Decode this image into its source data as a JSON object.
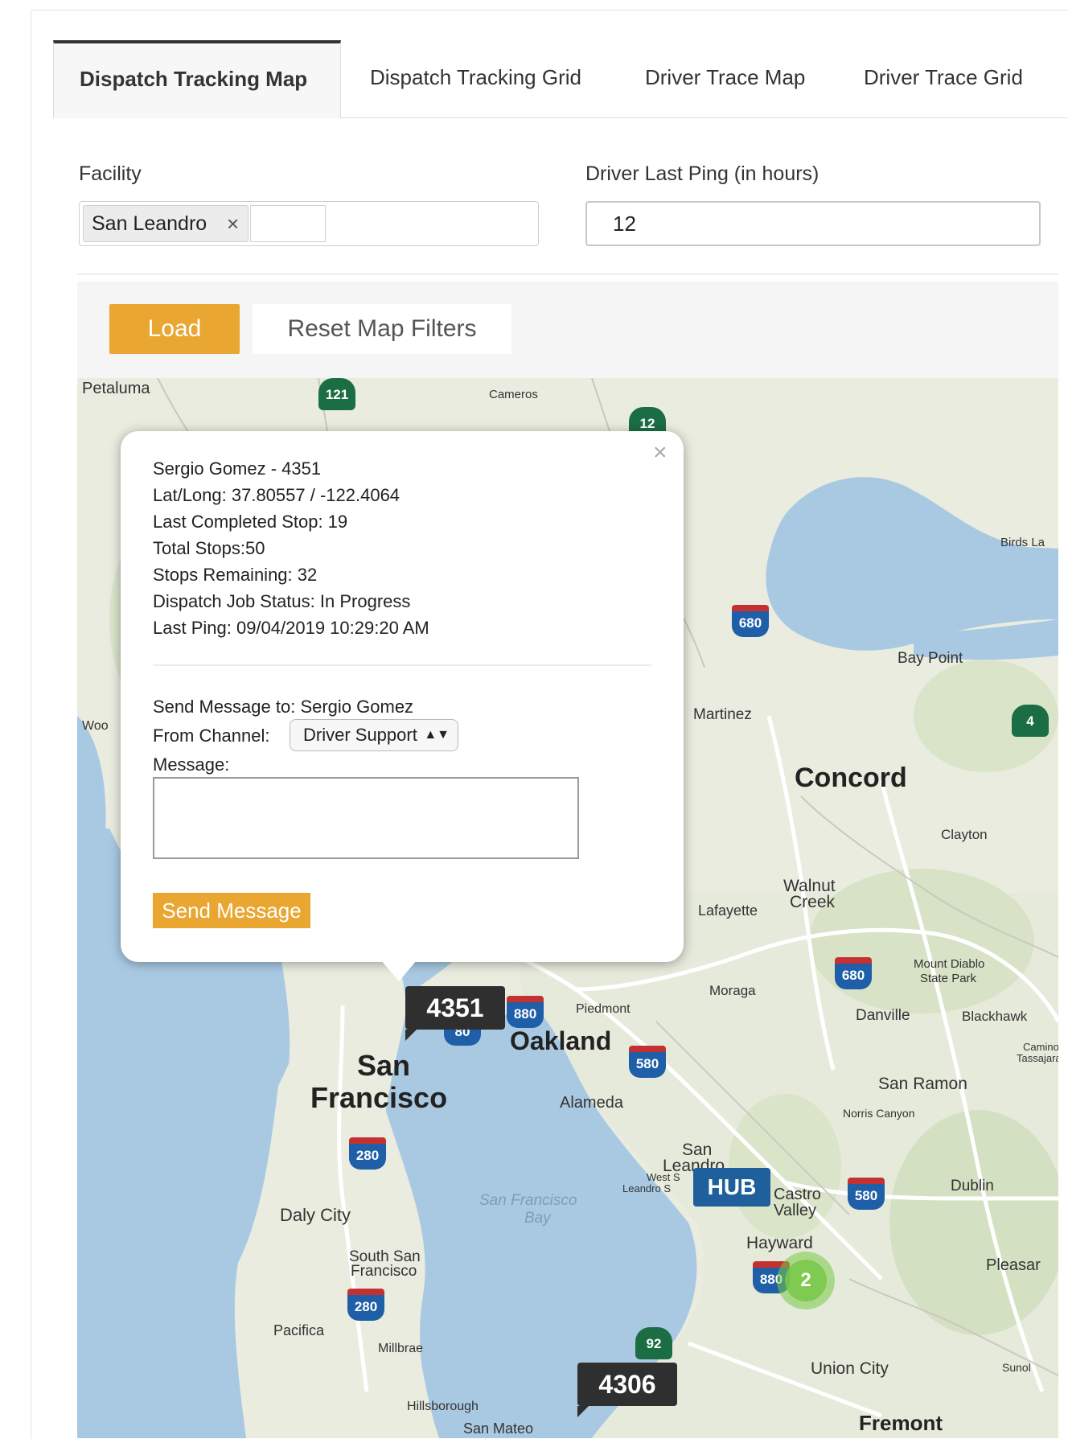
{
  "tabs": [
    {
      "label": "Dispatch Tracking Map",
      "active": true
    },
    {
      "label": "Dispatch Tracking Grid",
      "active": false
    },
    {
      "label": "Driver Trace Map",
      "active": false
    },
    {
      "label": "Driver Trace Grid",
      "active": false
    }
  ],
  "filters": {
    "facility_label": "Facility",
    "facility_chip": "San Leandro",
    "chip_remove": "×",
    "ping_label": "Driver Last Ping (in hours)",
    "ping_value": "12"
  },
  "buttons": {
    "load": "Load",
    "reset": "Reset Map Filters"
  },
  "popup": {
    "close": "×",
    "driver_line": "Sergio Gomez - 4351",
    "latlong": "Lat/Long: 37.80557 / -122.4064",
    "last_completed": "Last Completed Stop: 19",
    "total_stops": "Total Stops:50",
    "stops_remaining": "Stops Remaining: 32",
    "job_status": "Dispatch Job Status: In Progress",
    "last_ping": "Last Ping: 09/04/2019 10:29:20 AM",
    "send_to": "Send Message to: Sergio Gomez",
    "channel_label": "From Channel:",
    "channel_value": "Driver Support",
    "message_label": "Message:",
    "send_button": "Send Message"
  },
  "markers": {
    "driver1": "4351",
    "driver2": "4306",
    "hub": "HUB",
    "cluster": "2"
  },
  "map": {
    "cities": {
      "petaluma": "Petaluma",
      "cameros": "Cameros",
      "birds": "Birds La",
      "baypoint": "Bay Point",
      "martinez": "Martinez",
      "concord": "Concord",
      "clayton": "Clayton",
      "walnut": "Walnut",
      "creek": "Creek",
      "lafayette": "Lafayette",
      "mtdiablo1": "Mount Diablo",
      "mtdiablo2": "State Park",
      "moraga": "Moraga",
      "piedmont": "Piedmont",
      "danville": "Danville",
      "blackhawk": "Blackhawk",
      "camino1": "Camino",
      "camino2": "Tassajara",
      "oakland": "Oakland",
      "sf1": "San",
      "sf2": "Francisco",
      "alameda": "Alameda",
      "sanramon": "San Ramon",
      "norris": "Norris Canyon",
      "sanleandro1": "San",
      "sanleandro2": "Leandro",
      "westsl1": "West S",
      "westsl2": "Leandro S",
      "castro1": "Castro",
      "castro2": "Valley",
      "dublin": "Dublin",
      "dalycity": "Daly City",
      "sfbay1": "San Francisco",
      "sfbay2": "Bay",
      "hayward": "Hayward",
      "pleasanton": "Pleasar",
      "southsf1": "South San",
      "southsf2": "Francisco",
      "pacifica": "Pacifica",
      "millbrae": "Millbrae",
      "unioncity": "Union City",
      "sunol": "Sunol",
      "hillsborough": "Hillsborough",
      "sanmateo": "San Mateo",
      "fremont": "Fremont",
      "woo": "Woo"
    },
    "shields": {
      "r121": "121",
      "r12": "12",
      "r680a": "680",
      "r4": "4",
      "r680b": "680",
      "r880a": "880",
      "r80": "80",
      "r580a": "580",
      "r280a": "280",
      "r580b": "580",
      "r880b": "880",
      "r280b": "280",
      "r92": "92"
    }
  },
  "colors": {
    "accent": "#e9a630",
    "hub": "#1e5f9c",
    "marker": "#2f2f2f",
    "water": "#a9c9e3",
    "land": "#e9ecdf"
  }
}
